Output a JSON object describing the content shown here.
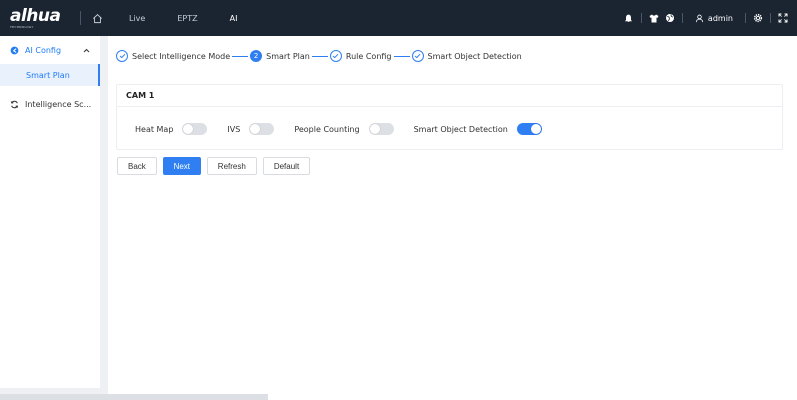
{
  "brand": {
    "logo": "alhua",
    "tagline": "TECHNOLOGY"
  },
  "nav": {
    "items": [
      {
        "label": "Live"
      },
      {
        "label": "EPTZ"
      },
      {
        "label": "AI"
      }
    ]
  },
  "header": {
    "user": "admin"
  },
  "sidebar": {
    "group": {
      "label": "AI Config",
      "icon": "ai-icon"
    },
    "sub": {
      "label": "Smart Plan"
    },
    "item": {
      "label": "Intelligence Sc...",
      "icon": "sync-icon"
    }
  },
  "steps": [
    {
      "label": "Select Intelligence Mode",
      "state": "done"
    },
    {
      "label": "Smart Plan",
      "state": "current",
      "num": "2"
    },
    {
      "label": "Rule Config",
      "state": "done"
    },
    {
      "label": "Smart Object Detection",
      "state": "done"
    }
  ],
  "card": {
    "title": "CAM 1"
  },
  "toggles": [
    {
      "label": "Heat Map",
      "on": false
    },
    {
      "label": "IVS",
      "on": false
    },
    {
      "label": "People Counting",
      "on": false
    },
    {
      "label": "Smart Object Detection",
      "on": true
    }
  ],
  "buttons": {
    "back": "Back",
    "next": "Next",
    "refresh": "Refresh",
    "default": "Default"
  },
  "colors": {
    "accent": "#2f7ff3",
    "topbar": "#1b2431"
  }
}
